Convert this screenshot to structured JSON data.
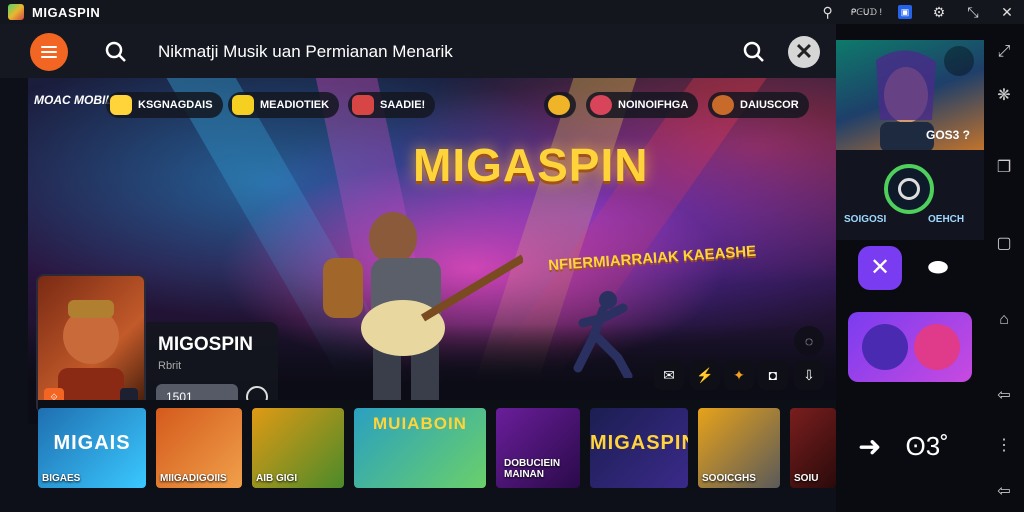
{
  "window": {
    "title": "MIGASPIN",
    "status_text": "ᑭᕮᑌᗪ !",
    "controls": [
      "ⓘ",
      "⚙",
      "✕"
    ]
  },
  "topbar": {
    "search_text": "Nikmatji Musik uan Permianan Menarik"
  },
  "hero": {
    "brand": "MOAC MOBILS",
    "chips": [
      "KSGNAGDAIS",
      "MEADIOTIEK",
      "SAADIE!",
      "NOINOIFHGA",
      "DAIUSCOR"
    ],
    "title": "MIGASPIN",
    "subtitle": "NFIERMIARRAIAK KAEASHE",
    "card_title": "MIGOSPIN",
    "card_sub": "Rbrit",
    "card_button": "1501",
    "card_badge": "⟐"
  },
  "actions": [
    "✉",
    "⚡",
    "✦",
    "◘",
    "⇩"
  ],
  "strip": {
    "tiles": [
      {
        "label": "MIGAIS",
        "caption": "BIGAES",
        "color": "#1f6fb0"
      },
      {
        "label": "",
        "caption": "MIIGADIGOIIS",
        "color": "#d45a1c"
      },
      {
        "label": "",
        "caption": "AIB GIGI",
        "color": "#e09a14"
      },
      {
        "label": "MUIABOIN",
        "caption": "",
        "color": "#2aa0c0"
      },
      {
        "label": "",
        "caption": "DOBUCIEIN MAINAN",
        "color": "#6a1e9a"
      },
      {
        "label": "MIGASPIN",
        "caption": "",
        "color": "#1c1e52"
      },
      {
        "label": "",
        "caption": "SOOICGHS",
        "color": "#e7a21a"
      },
      {
        "label": "",
        "caption": "SOIU",
        "color": "#7a1e1e"
      }
    ]
  },
  "side": {
    "top_label": "GOS3 ?",
    "mid_left": "SOIGOSI",
    "mid_right": "OEHCH",
    "bottom_arrow": "➜",
    "bottom_label": "ʘ3˚"
  }
}
